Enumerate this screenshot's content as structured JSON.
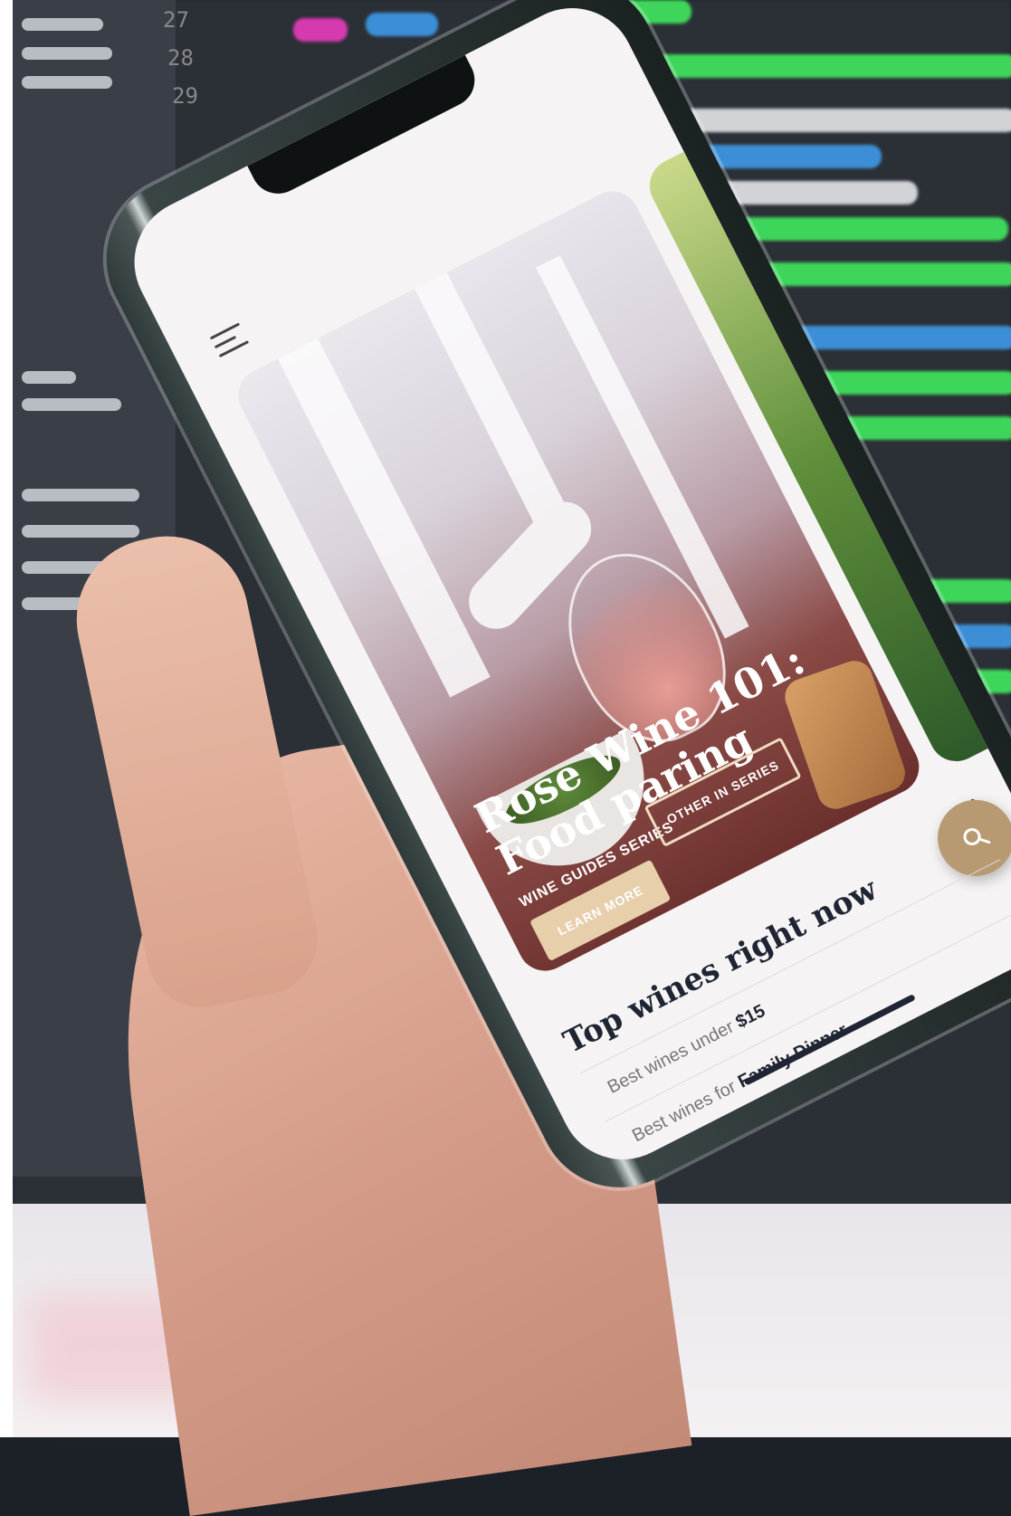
{
  "app": {
    "hero": {
      "title_line1": "Rose Wine 101:",
      "title_line2": "Food paring",
      "eyebrow": "WINE GUIDES SERIES",
      "primary_button": "LEARN MORE",
      "secondary_button": "OTHER IN SERIES"
    },
    "section": {
      "title": "Top wines right now",
      "chevron": "›"
    },
    "list": [
      {
        "prefix": "Best wines under ",
        "highlight": "$15"
      },
      {
        "prefix": "Best wines for ",
        "highlight": "Family Dinner"
      }
    ]
  },
  "background": {
    "line_numbers": [
      "27",
      "28",
      "29"
    ]
  },
  "colors": {
    "accent": "#b89a72",
    "learn_button": "#e6cfaa",
    "title_text": "#1f2533",
    "code_green": "#3ed65a",
    "code_blue": "#3c8fd6",
    "code_pink": "#d63ab0"
  },
  "icons": {
    "menu": "hamburger-menu-icon",
    "search": "search-icon",
    "chevron": "chevron-right-icon"
  }
}
